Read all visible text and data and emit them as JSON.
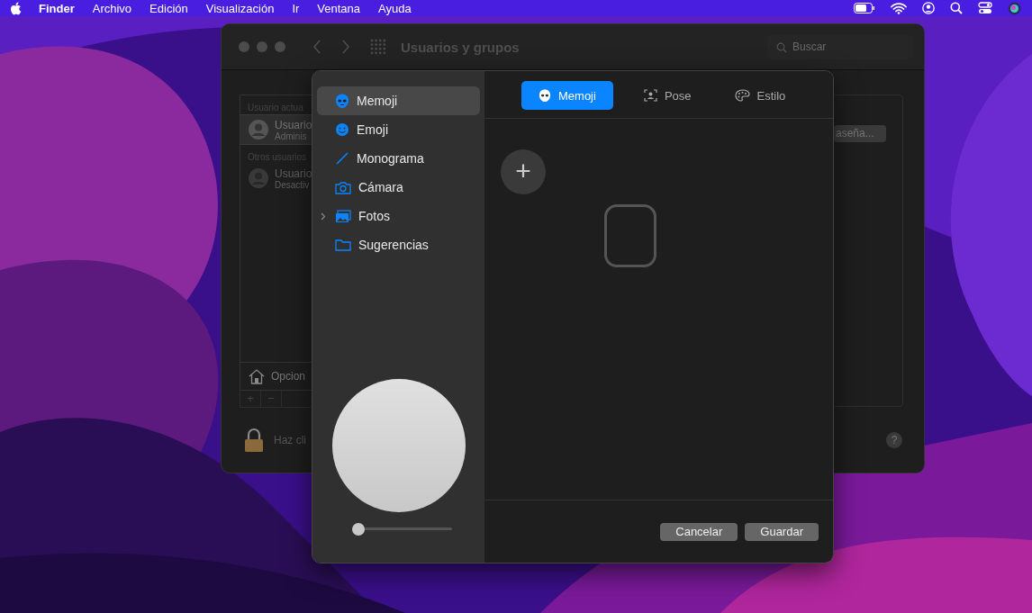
{
  "menu_bar": {
    "items": [
      {
        "label": "Finder"
      },
      {
        "label": "Archivo"
      },
      {
        "label": "Edición"
      },
      {
        "label": "Visualización"
      },
      {
        "label": "Ir"
      },
      {
        "label": "Ventana"
      },
      {
        "label": "Ayuda"
      }
    ]
  },
  "window": {
    "title": "Usuarios y grupos",
    "search": {
      "placeholder": "Buscar"
    },
    "users_list": {
      "sections": [
        {
          "header": "Usuario actua",
          "users": [
            {
              "name": "Usuario",
              "role": "Adminis",
              "selected": true,
              "disabled": false
            }
          ]
        },
        {
          "header": "Otros usuarios",
          "users": [
            {
              "name": "Usuario",
              "role": "Desactiv",
              "selected": false,
              "disabled": true
            }
          ]
        }
      ],
      "options_label": "Opcion",
      "add_button": "+",
      "remove_button": "−"
    },
    "password_button": "aseña...",
    "lock_text": "Haz cli",
    "help_button": "?"
  },
  "sheet": {
    "sidebar": [
      {
        "label": "Memoji",
        "selected": true
      },
      {
        "label": "Emoji",
        "selected": false
      },
      {
        "label": "Monograma",
        "selected": false
      },
      {
        "label": "Cámara",
        "selected": false
      },
      {
        "label": "Fotos",
        "selected": false,
        "expanded": false
      },
      {
        "label": "Sugerencias",
        "selected": false
      }
    ],
    "tabs": [
      {
        "label": "Memoji",
        "selected": true
      },
      {
        "label": "Pose",
        "selected": false
      },
      {
        "label": "Estilo",
        "selected": false
      }
    ],
    "add_button": "+",
    "zoom_slider": {
      "level": 0.05
    },
    "buttons": [
      {
        "label": "Cancelar"
      },
      {
        "label": "Guardar"
      }
    ]
  }
}
